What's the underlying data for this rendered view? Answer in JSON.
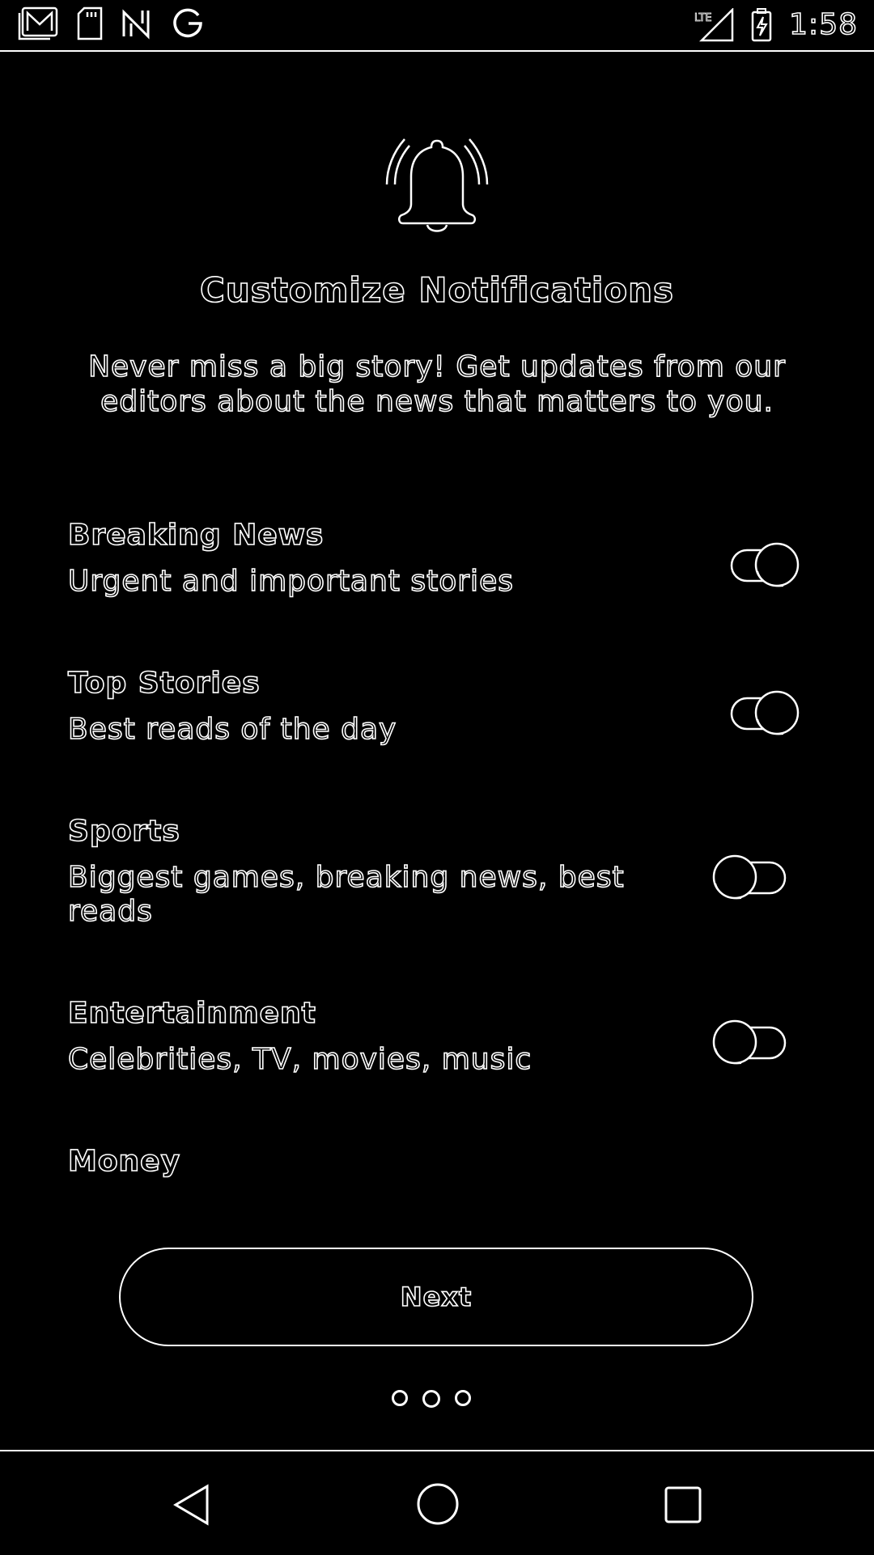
{
  "status_bar": {
    "left_icons": [
      "gallery-icon",
      "sd-card-icon",
      "news-app-icon",
      "google-icon"
    ],
    "network": "LTE",
    "battery": "battery-charging-icon",
    "time": "1:58"
  },
  "header": {
    "icon": "bell-ringing-icon",
    "title": "Customize Notifications",
    "subtitle": "Never miss a big story! Get updates from our editors about the news that matters to you."
  },
  "settings": [
    {
      "title": "Breaking News",
      "description": "Urgent and important stories",
      "enabled": true
    },
    {
      "title": "Top Stories",
      "description": "Best reads of the day",
      "enabled": true
    },
    {
      "title": "Sports",
      "description": "Biggest games, breaking news, best reads",
      "enabled": false
    },
    {
      "title": "Entertainment",
      "description": "Celebrities, TV, movies, music",
      "enabled": false
    },
    {
      "title": "Money",
      "description": "",
      "enabled": false
    }
  ],
  "next_button": {
    "label": "Next"
  },
  "pager": {
    "count": 3,
    "active_index": 1
  },
  "nav_bar": {
    "items": [
      "back-icon",
      "home-icon",
      "recents-icon"
    ]
  }
}
